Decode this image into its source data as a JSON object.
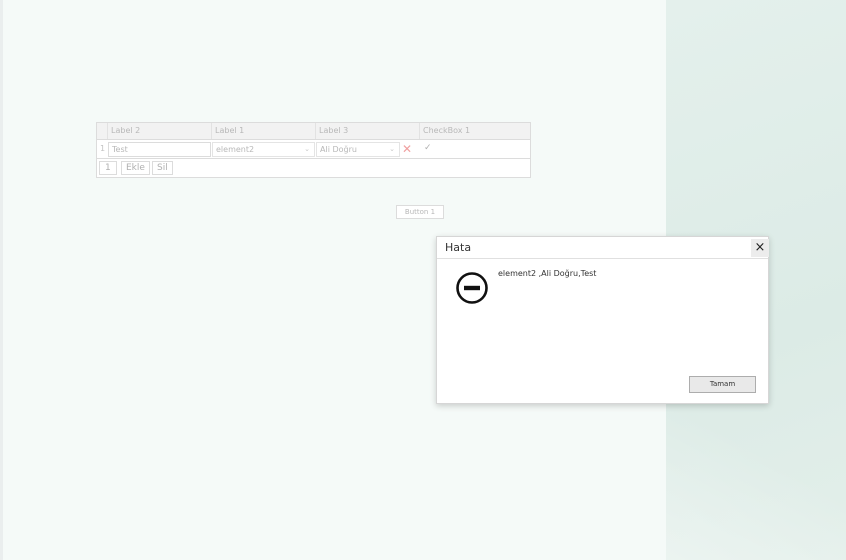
{
  "grid": {
    "columns": [
      "Label 2",
      "Label 1",
      "Label 3",
      "CheckBox 1"
    ],
    "rows": [
      {
        "row_number": "1",
        "label2": "Test",
        "label1": "element2",
        "label3": "Ali Doğru",
        "checkbox": "✓"
      }
    ],
    "pager": "1",
    "buttons": {
      "add": "Ekle",
      "delete": "Sil"
    }
  },
  "button1": {
    "label": "Button 1"
  },
  "dialog": {
    "title": "Hata",
    "message": "element2 ,Ali Doğru,Test",
    "ok_label": "Tamam",
    "close_glyph": "×"
  },
  "icons": {
    "delete": "delete-x-icon",
    "check": "check-icon",
    "dropdown": "chevron-down-icon",
    "error": "stop-icon"
  },
  "colors": {
    "background_main": "#f5faf8",
    "background_side": "#e2efea",
    "delete_red": "#f0a0a0"
  }
}
